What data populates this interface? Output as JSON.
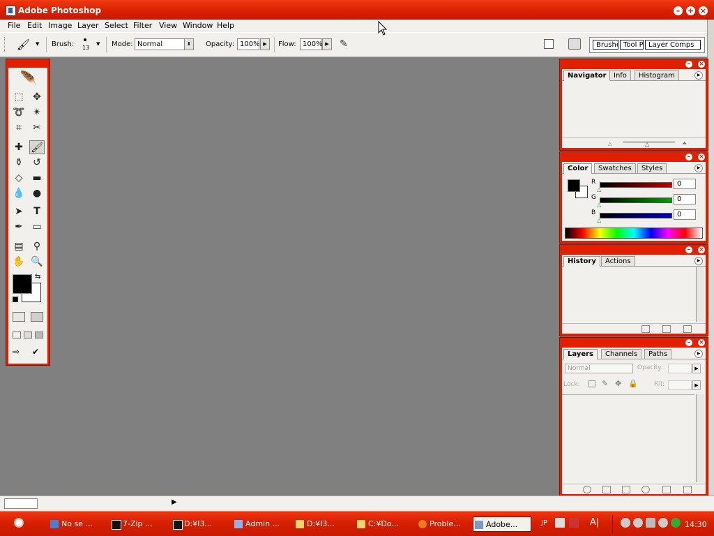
{
  "window": {
    "title": "Adobe Photoshop"
  },
  "menu": [
    "File",
    "Edit",
    "Image",
    "Layer",
    "Select",
    "Filter",
    "View",
    "Window",
    "Help"
  ],
  "options": {
    "brush_label": "Brush:",
    "brush_size": "13",
    "mode_label": "Mode:",
    "mode_value": "Normal",
    "opacity_label": "Opacity:",
    "opacity_value": "100%",
    "flow_label": "Flow:",
    "flow_value": "100%"
  },
  "well_tabs": [
    "Brushes",
    "Tool Presets",
    "Layer Comps"
  ],
  "panels": {
    "navigator_tabs": [
      "Navigator",
      "Info",
      "Histogram"
    ],
    "color_tabs": [
      "Color",
      "Swatches",
      "Styles"
    ],
    "color": {
      "r_label": "R",
      "g_label": "G",
      "b_label": "B",
      "r_value": "0",
      "g_value": "0",
      "b_value": "0",
      "r_color": "#c00000",
      "g_color": "#00a000",
      "b_color": "#0000c0"
    },
    "history_tabs": [
      "History",
      "Actions"
    ],
    "layers_tabs": [
      "Layers",
      "Channels",
      "Paths"
    ],
    "layers": {
      "blend_mode": "Normal",
      "opacity_label": "Opacity:",
      "lock_label": "Lock:",
      "fill_label": "Fill:"
    }
  },
  "taskbar": {
    "tasks": [
      "No se ...",
      "7-Zip ...",
      "D:¥I3...",
      "Admin ...",
      "D:¥I3...",
      "C:¥Do...",
      "Proble...",
      "Adobe..."
    ],
    "lang": "JP",
    "clock": "14:30"
  },
  "colors": {
    "accent": "#e02000",
    "canvas": "#808080",
    "panel": "#f1f0ec"
  }
}
